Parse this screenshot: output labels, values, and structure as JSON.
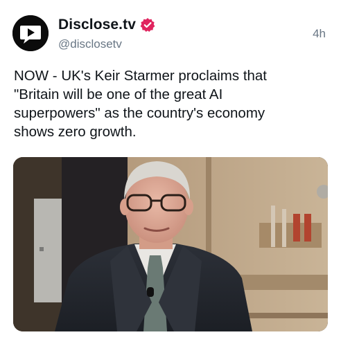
{
  "post": {
    "author": {
      "display_name": "Disclose.tv",
      "handle": "@disclosetv",
      "avatar_icon": "disclose-tv-logo-icon",
      "verified_icon": "verified-badge-icon",
      "verified_color": "#e0245e"
    },
    "timestamp": "4h",
    "text": "NOW - UK's Keir Starmer proclaims that\n\"Britain will be one of the great AI\nsuperpowers\" as the country's economy\nshows zero growth.",
    "media": {
      "type": "photo"
    }
  }
}
